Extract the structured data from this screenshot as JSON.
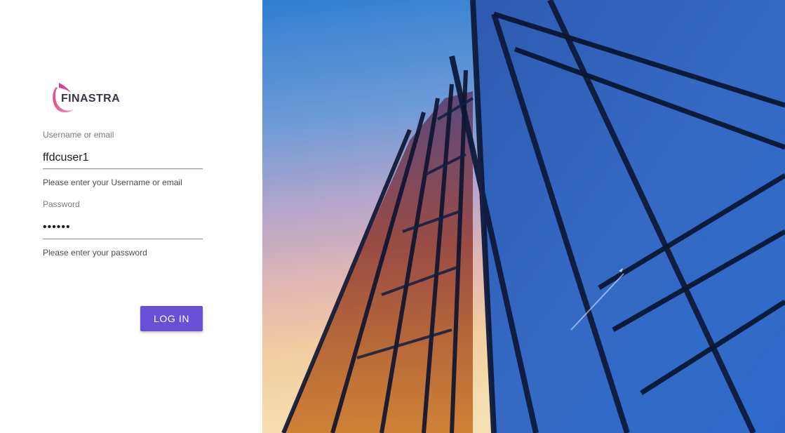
{
  "brand": {
    "name": "FINASTRA",
    "accent_color": "#694ed6"
  },
  "login_form": {
    "username": {
      "label": "Username or email",
      "value": "ffdcuser1",
      "helper": "Please enter your Username or email"
    },
    "password": {
      "label": "Password",
      "value": "••••••",
      "helper": "Please enter your password"
    },
    "submit_label": "LOG IN"
  },
  "hero": {
    "image": "glass-skyscraper-sunset-photo"
  }
}
